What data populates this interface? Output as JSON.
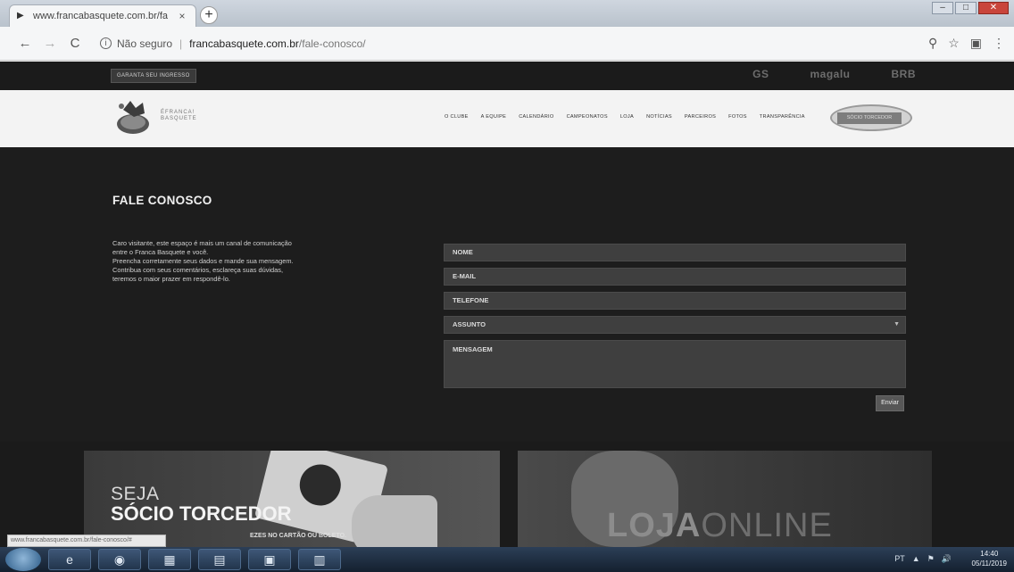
{
  "browser": {
    "tab_title": "www.francabasquete.com.br/fa",
    "tab_close": "×",
    "new_tab": "+",
    "back": "←",
    "forward": "→",
    "reload": "C",
    "security_label": "Não seguro",
    "url_domain": "francabasquete.com.br",
    "url_path": "/fale-conosco/",
    "icons": [
      "back-icon",
      "forward-icon",
      "reload-icon",
      "info-icon",
      "search-icon",
      "star-icon",
      "menu-icon"
    ]
  },
  "site": {
    "top_strip": {
      "ticket_button": "GARANTA SEU INGRESSO",
      "sponsors": [
        "GS",
        "magalu",
        "BRB"
      ]
    },
    "logo_text": [
      "ÉFRANCA!",
      "BASQUETE"
    ],
    "menu": [
      "O CLUBE",
      "A EQUIPE",
      "CALENDÁRIO",
      "CAMPEONATOS",
      "LOJA",
      "NOTÍCIAS",
      "PARCEIROS",
      "FOTOS",
      "TRANSPARÊNCIA"
    ],
    "member_button": "SÓCIO TORCEDOR",
    "contact": {
      "title": "FALE CONOSCO",
      "text": [
        "Caro visitante, este espaço é mais um canal de comunicação",
        "entre o Franca Basquete e você.",
        "Preencha corretamente seus dados e mande sua mensagem.",
        "Contribua com seus comentários, esclareça suas dúvidas,",
        "teremos o maior prazer em respondê-lo."
      ],
      "fields": {
        "name": "NOME",
        "email": "E-MAIL",
        "phone": "TELEFONE",
        "subject": "ASSUNTO",
        "message": "MENSAGEM"
      },
      "send_button": "Enviar"
    },
    "banners": {
      "seja": "SEJA",
      "socio": "SÓCIO TORCEDOR",
      "promo": "EZES NO CARTÃO OU BOLETO.",
      "loja_bold": "LOJA",
      "loja_thin": "ONLINE"
    }
  },
  "status_url": "www.francabasquete.com.br/fale-conosco/#",
  "taskbar": {
    "items": [
      "e",
      "◉",
      "▦",
      "▤",
      "▣",
      "▥"
    ],
    "tray": [
      "PT",
      "▲",
      "⚑",
      "🔊"
    ],
    "time": "14:40",
    "date": "05/11/2019"
  }
}
